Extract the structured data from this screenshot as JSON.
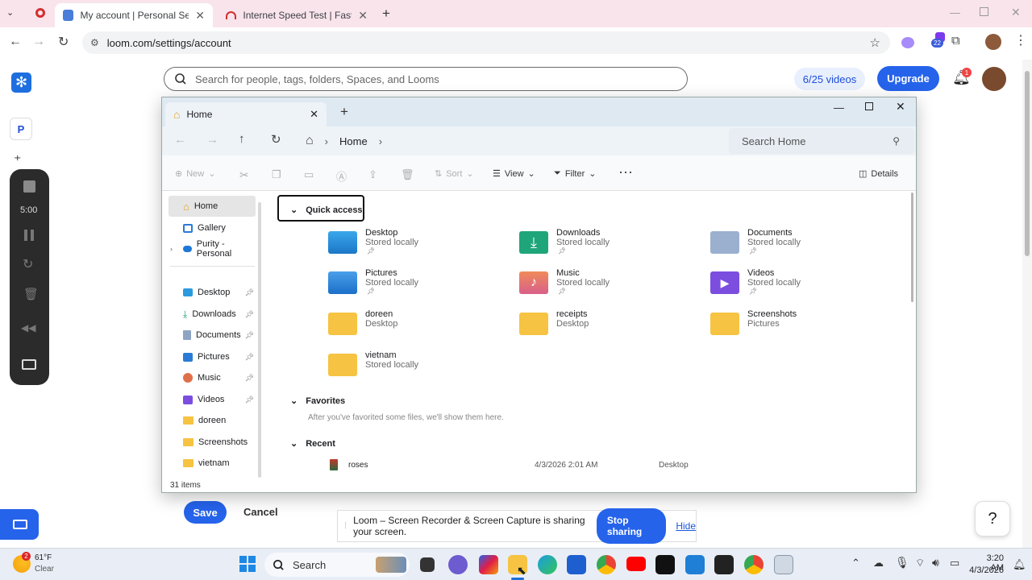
{
  "browser": {
    "tabs": [
      {
        "title": "My account | Personal Settings"
      },
      {
        "title": "Internet Speed Test | Fast.com"
      }
    ],
    "url": "loom.com/settings/account",
    "profile_badge": "22"
  },
  "loom": {
    "search_placeholder": "Search for people, tags, folders, Spaces, and Looms",
    "videos_count": "6/25 videos",
    "upgrade_label": "Upgrade",
    "notification_count": "1",
    "workspace_initial": "P",
    "save_label": "Save",
    "cancel_label": "Cancel",
    "help_label": "?",
    "recorder_timer": "5:00"
  },
  "explorer": {
    "tab_title": "Home",
    "breadcrumb": "Home",
    "search_placeholder": "Search Home",
    "commands": {
      "new": "New",
      "sort": "Sort",
      "view": "View",
      "filter": "Filter",
      "details": "Details"
    },
    "sidebar": [
      {
        "label": "Home"
      },
      {
        "label": "Gallery"
      },
      {
        "label": "Purity - Personal"
      },
      {
        "label": "Desktop",
        "pinned": true
      },
      {
        "label": "Downloads",
        "pinned": true
      },
      {
        "label": "Documents",
        "pinned": true
      },
      {
        "label": "Pictures",
        "pinned": true
      },
      {
        "label": "Music",
        "pinned": true
      },
      {
        "label": "Videos",
        "pinned": true
      },
      {
        "label": "doreen"
      },
      {
        "label": "Screenshots"
      },
      {
        "label": "vietnam"
      }
    ],
    "quick_access_label": "Quick access",
    "quick_access": [
      {
        "name": "Desktop",
        "sub": "Stored locally",
        "pinned": true,
        "icon": "desktop-folder"
      },
      {
        "name": "Downloads",
        "sub": "Stored locally",
        "pinned": true,
        "icon": "downloads-folder"
      },
      {
        "name": "Documents",
        "sub": "Stored locally",
        "pinned": true,
        "icon": "documents-folder"
      },
      {
        "name": "Pictures",
        "sub": "Stored locally",
        "pinned": true,
        "icon": "pictures-folder"
      },
      {
        "name": "Music",
        "sub": "Stored locally",
        "pinned": true,
        "icon": "music-folder"
      },
      {
        "name": "Videos",
        "sub": "Stored locally",
        "pinned": true,
        "icon": "videos-folder"
      },
      {
        "name": "doreen",
        "sub": "Desktop",
        "pinned": false,
        "icon": "yellow-folder"
      },
      {
        "name": "receipts",
        "sub": "Desktop",
        "pinned": false,
        "icon": "yellow-folder"
      },
      {
        "name": "Screenshots",
        "sub": "Pictures",
        "pinned": false,
        "icon": "yellow-folder"
      },
      {
        "name": "vietnam",
        "sub": "Stored locally",
        "pinned": false,
        "icon": "yellow-folder"
      }
    ],
    "favorites_label": "Favorites",
    "favorites_empty": "After you've favorited some files, we'll show them here.",
    "recent_label": "Recent",
    "recent": [
      {
        "name": "roses",
        "date": "4/3/2026 2:01 AM",
        "location": "Desktop"
      }
    ],
    "status": "31 items"
  },
  "share_banner": {
    "text": "Loom – Screen Recorder & Screen Capture is sharing your screen.",
    "stop_label": "Stop sharing",
    "hide_label": "Hide"
  },
  "taskbar": {
    "weather_temp": "61°F",
    "weather_desc": "Clear",
    "weather_badge": "2",
    "search_label": "Search",
    "time": "3:20 AM",
    "date": "4/3/2026"
  },
  "colors": {
    "accent": "#2563eb",
    "tabbar": "#f9e4ec",
    "folder": "#f6c342"
  }
}
